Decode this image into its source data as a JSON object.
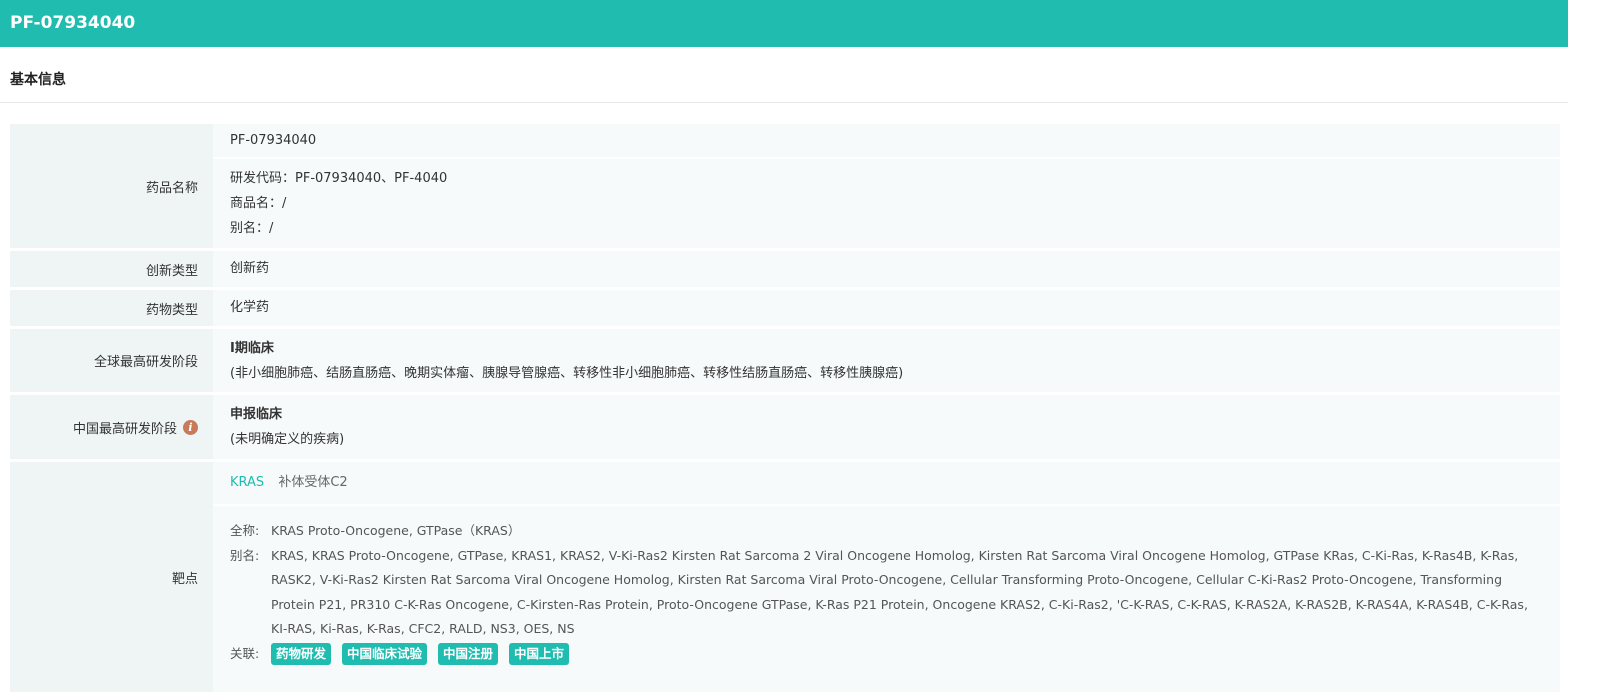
{
  "header": {
    "title": "PF-07934040"
  },
  "section": {
    "title": "基本信息"
  },
  "rows": {
    "name": {
      "label": "药品名称",
      "primary": "PF-07934040",
      "code": "研发代码：PF-07934040、PF-4040",
      "trade": "商品名：/",
      "alias": "别名：/"
    },
    "innovation": {
      "label": "创新类型",
      "value": "创新药"
    },
    "drug_type": {
      "label": "药物类型",
      "value": "化学药"
    },
    "global_stage": {
      "label": "全球最高研发阶段",
      "stage": "Ⅰ期临床",
      "indications": "(非小细胞肺癌、结肠直肠癌、晚期实体瘤、胰腺导管腺癌、转移性非小细胞肺癌、转移性结肠直肠癌、转移性胰腺癌)"
    },
    "china_stage": {
      "label": "中国最高研发阶段",
      "info_icon": "i",
      "stage": "申报临床",
      "indications": "(未明确定义的疾病)"
    },
    "target": {
      "label": "靶点",
      "links": [
        "KRAS",
        "补体受体C2"
      ],
      "fullname_key": "全称:",
      "fullname": "KRAS Proto-Oncogene, GTPase（KRAS）",
      "alias_key": "别名:",
      "aliases": "KRAS, KRAS Proto-Oncogene, GTPase, KRAS1, KRAS2, V-Ki-Ras2 Kirsten Rat Sarcoma 2 Viral Oncogene Homolog, Kirsten Rat Sarcoma Viral Oncogene Homolog, GTPase KRas, C-Ki-Ras, K-Ras4B, K-Ras, RASK2, V-Ki-Ras2 Kirsten Rat Sarcoma Viral Oncogene Homolog, Kirsten Rat Sarcoma Viral Proto-Oncogene, Cellular Transforming Proto-Oncogene, Cellular C-Ki-Ras2 Proto-Oncogene, Transforming Protein P21, PR310 C-K-Ras Oncogene, C-Kirsten-Ras Protein, Proto-Oncogene GTPase, K-Ras P21 Protein, Oncogene KRAS2, C-Ki-Ras2, 'C-K-RAS, C-K-RAS, K-RAS2A, K-RAS2B, K-RAS4A, K-RAS4B, C-K-Ras, KI-RAS, Ki-Ras, K-Ras, CFC2, RALD, NS3, OES, NS",
      "related_key": "关联:",
      "tags": [
        "药物研发",
        "中国临床试验",
        "中国注册",
        "中国上市"
      ]
    }
  },
  "colors": {
    "accent": "#20bcb0",
    "info": "#c97a5a"
  }
}
